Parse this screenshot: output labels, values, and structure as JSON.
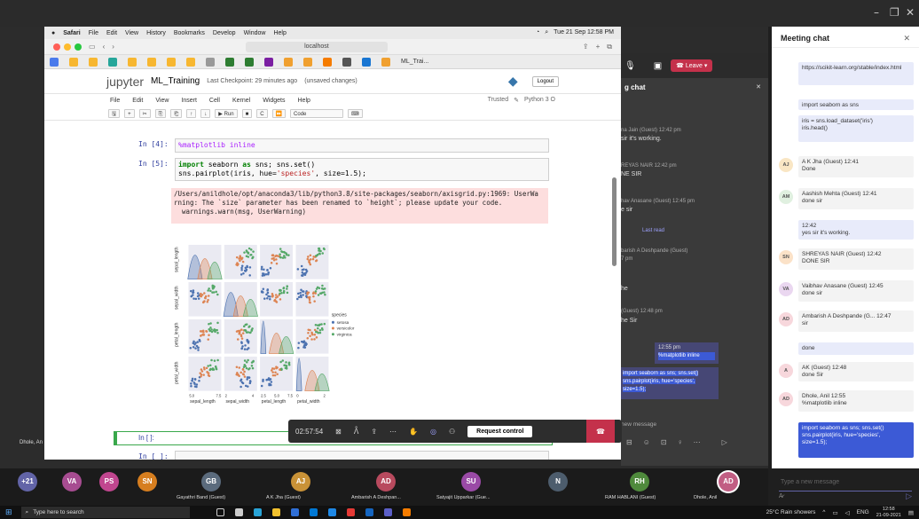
{
  "window": {
    "minimize": "–",
    "restore": "❐",
    "close": "✕"
  },
  "mac_menu": {
    "apple": "",
    "items": [
      "Safari",
      "File",
      "Edit",
      "View",
      "History",
      "Bookmarks",
      "Develop",
      "Window",
      "Help"
    ],
    "clock": "Tue 21 Sep 12:58 PM"
  },
  "safari": {
    "url": "localhost",
    "tab_label": "ML_Trai..."
  },
  "jupyter": {
    "logo": "jupyter",
    "notebook": "ML_Training",
    "checkpoint": "Last Checkpoint: 29 minutes ago",
    "unsaved": "(unsaved changes)",
    "logout": "Logout",
    "menu": [
      "File",
      "Edit",
      "View",
      "Insert",
      "Cell",
      "Kernel",
      "Widgets",
      "Help"
    ],
    "trusted": "Trusted",
    "kernel": "Python 3 O",
    "toolbar": [
      "🖫",
      "+",
      "✂",
      "⎘",
      "⎗",
      "↑",
      "↓",
      "▶ Run",
      "■",
      "C",
      "⏩",
      "Code",
      "⌨"
    ]
  },
  "cells": {
    "c4_prompt": "In [4]:",
    "c4_code": "%matplotlib inline",
    "c5_prompt": "In [5]:",
    "c5_line1a": "import",
    "c5_line1b": " seaborn ",
    "c5_line1c": "as",
    "c5_line1d": " sns; sns.set()",
    "c5_line2a": "sns.pairplot(iris, hue=",
    "c5_line2b": "'species'",
    "c5_line2c": ", size=1.5);",
    "warning": "/Users/anildhole/opt/anaconda3/lib/python3.8/site-packages/seaborn/axisgrid.py:1969: UserWa\nrning: The `size` parameter has been renamed to `height`; please update your code.\n  warnings.warn(msg, UserWarning)",
    "empty1": "In [ ]:",
    "empty2": "In [ ]:"
  },
  "pairplot": {
    "ylabels": [
      "sepal_length",
      "sepal_width",
      "petal_length",
      "petal_width"
    ],
    "xlabels": [
      "sepal_length",
      "sepal_width",
      "petal_length",
      "petal_width"
    ],
    "xticks": [
      [
        "5.0",
        "7.5"
      ],
      [
        "2",
        "4"
      ],
      [
        "2.5",
        "5.0",
        "7.5"
      ],
      [
        "0",
        "2"
      ]
    ],
    "legend_title": "species",
    "legend": [
      {
        "name": "setosa",
        "color": "#4c72b0"
      },
      {
        "name": "versicolor",
        "color": "#dd8452"
      },
      {
        "name": "virginica",
        "color": "#55a868"
      }
    ]
  },
  "meeting_controls": {
    "timer": "02:57:54",
    "request_control": "Request control"
  },
  "teams_mini": {
    "leave": "Leave",
    "chat_header": "g chat",
    "items": [
      "na Jain (Guest) 12:42 pm",
      "sir it's working.",
      "REYAS NAIR 12:42 pm",
      "NE SIR",
      "hav Anasane (Guest) 12:45 pm",
      "e sir",
      "Last read",
      "barish A Deshpande (Guest)",
      "7 pm",
      "he",
      "(Guest) 12:48 pm",
      "he Sir",
      "12:55 pm",
      "%matplotlib inline"
    ],
    "new_message": "new message"
  },
  "chat": {
    "title": "Meeting chat",
    "messages": [
      {
        "avatar": "",
        "text": "https://scikit-learn.org/stable/index.html"
      },
      {
        "avatar": "",
        "text": "import seaborn as sns"
      },
      {
        "avatar": "",
        "text": "iris = sns.load_dataset('iris')\niris.head()"
      },
      {
        "avatar": "AJ",
        "text": "A K Jha (Guest) 12:41\nDone"
      },
      {
        "avatar": "AM",
        "text": "Aashish Mehta (Guest) 12:41\ndone sir"
      },
      {
        "avatar": "",
        "text": "12:42\nyes sir it's working."
      },
      {
        "avatar": "SN",
        "text": "SHREYAS NAIR (Guest) 12:42\nDONE SIR"
      },
      {
        "avatar": "VA",
        "text": "Vaibhav Anasane (Guest) 12:45\ndone sir"
      },
      {
        "avatar": "AD",
        "text": "Ambarish A Deshpande (G... 12:47\nsir"
      },
      {
        "avatar": "",
        "text": "done"
      },
      {
        "avatar": "A",
        "text": "AK (Guest) 12:48\ndone Sir"
      },
      {
        "avatar": "AD",
        "text": "Dhole, Anil 12:55\n%matplotlib inline"
      },
      {
        "avatar": "",
        "text": "import seaborn as sns; sns.set()\nsns.pairplot(iris, hue='species',\nsize=1.5);"
      }
    ],
    "compose": "Type a new message"
  },
  "participants": [
    {
      "initials": "+21",
      "color": "#6264a7",
      "name": ""
    },
    {
      "initials": "VA",
      "color": "#a74c91",
      "name": ""
    },
    {
      "initials": "PS",
      "color": "#c1468f",
      "name": ""
    },
    {
      "initials": "SN",
      "color": "#d67e1f",
      "name": ""
    },
    {
      "initials": "GB",
      "color": "#5b6b7d",
      "name": "Gayathri Band (Guest)"
    },
    {
      "initials": "AJ",
      "color": "#c99237",
      "name": "A K Jha (Guest)"
    },
    {
      "initials": "AD",
      "color": "#b84a5e",
      "name": "Ambarish A Deshpan..."
    },
    {
      "initials": "SU",
      "color": "#9a4aa6",
      "name": "Satyajit Upparkar (Gue..."
    },
    {
      "initials": "N",
      "color": "#4d5d6d",
      "name": ""
    },
    {
      "initials": "RH",
      "color": "#4f8a3c",
      "name": "RAM HABLANI (Guest)"
    },
    {
      "initials": "AD",
      "color": "#c15e83",
      "name": "Dhole, Anil"
    }
  ],
  "left_name": "Dhole, An",
  "taskbar": {
    "search": "Type here to search",
    "weather": "25°C Rain showers",
    "lang": "ENG",
    "time": "12:58",
    "date": "21-09-2021"
  }
}
